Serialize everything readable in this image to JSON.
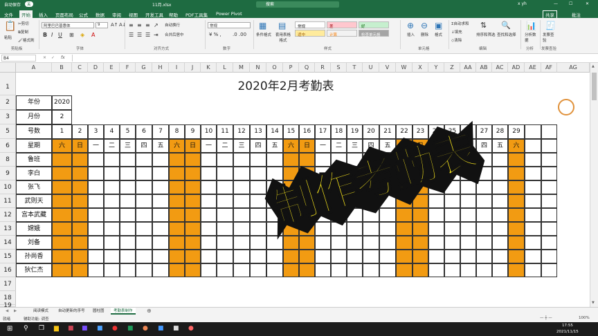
{
  "titlebar": {
    "autosave": "自动保存",
    "autosave_state": "关",
    "filename": "11月.xlsx",
    "search": "搜索",
    "user": "x yh"
  },
  "menu": {
    "tabs": [
      "文件",
      "开始",
      "插入",
      "页面布局",
      "公式",
      "数据",
      "审阅",
      "视图",
      "开发工具",
      "帮助",
      "PDF工具集",
      "Power Pivot"
    ],
    "active": "开始",
    "share": "共享",
    "comment": "批注"
  },
  "ribbon": {
    "clipboard": {
      "paste": "粘贴",
      "cut": "剪切",
      "copy": "复制",
      "format_painter": "格式刷",
      "label": "剪贴板"
    },
    "font": {
      "name": "阿里巴巴普惠体",
      "size": "9",
      "label": "字体"
    },
    "alignment": {
      "wrap": "自动换行",
      "merge": "合并后居中",
      "label": "对齐方式"
    },
    "number": {
      "format": "常规",
      "label": "数字"
    },
    "styles": {
      "cond": "条件格式",
      "table": "套用表格格式",
      "normal": "常规",
      "bad": "差",
      "good": "好",
      "neutral": "适中",
      "calc": "计算",
      "check": "检查单元格",
      "label": "样式"
    },
    "cells": {
      "insert": "插入",
      "delete": "删除",
      "format": "格式",
      "label": "单元格"
    },
    "editing": {
      "autosum": "自动求和",
      "fill": "填充",
      "clear": "清除",
      "sort": "排序和筛选",
      "find": "查找和选择",
      "label": "编辑"
    },
    "analysis": {
      "analyze": "分析数据",
      "label": "分析"
    },
    "invoice": {
      "check": "发票查验",
      "label": "发票查验"
    }
  },
  "formula_bar": {
    "name_box": "B4",
    "fx": "fx",
    "value": ""
  },
  "columns": [
    "A",
    "B",
    "C",
    "D",
    "E",
    "F",
    "G",
    "H",
    "I",
    "J",
    "K",
    "L",
    "M",
    "N",
    "O",
    "P",
    "Q",
    "R",
    "S",
    "T",
    "U",
    "V",
    "W",
    "X",
    "Y",
    "Z",
    "AA",
    "AB",
    "AC",
    "AD",
    "AE",
    "AF",
    "AG"
  ],
  "rows": [
    "1",
    "2",
    "3",
    "5",
    "6",
    "8",
    "9",
    "10",
    "11",
    "12",
    "13",
    "14",
    "15",
    "16",
    "17",
    "18",
    "19"
  ],
  "sheet": {
    "title": "2020年2月考勤表",
    "year_label": "年份",
    "year": "2020",
    "month_label": "月份",
    "month": "2",
    "day_label": "号数",
    "weekday_label": "星期",
    "days": [
      "1",
      "2",
      "3",
      "4",
      "5",
      "6",
      "7",
      "8",
      "9",
      "10",
      "11",
      "12",
      "13",
      "14",
      "15",
      "16",
      "17",
      "18",
      "19",
      "20",
      "21",
      "22",
      "23",
      "24",
      "25",
      "26",
      "27",
      "28",
      "29",
      "",
      ""
    ],
    "weekdays": [
      "六",
      "日",
      "一",
      "二",
      "三",
      "四",
      "五",
      "六",
      "日",
      "一",
      "二",
      "三",
      "四",
      "五",
      "六",
      "日",
      "一",
      "二",
      "三",
      "四",
      "五",
      "六",
      "日",
      "一",
      "二",
      "三",
      "四",
      "五",
      "六",
      "",
      ""
    ],
    "weekend_days": [
      1,
      2,
      8,
      9,
      15,
      16,
      22,
      23,
      29
    ],
    "names": [
      "鲁班",
      "李白",
      "张飞",
      "武则天",
      "宫本武藏",
      "嫦娥",
      "刘备",
      "孙尚香",
      "狄仁杰"
    ]
  },
  "overlay_text": "制作考勤表",
  "sheet_tabs": [
    "阅读模式",
    "自动更新的序号",
    "圆柱图",
    "考勤表制作"
  ],
  "active_sheet": "考勤表制作",
  "status": {
    "ready": "就绪",
    "accessibility": "辅助功能: 调查",
    "zoom": "100%"
  },
  "taskbar": {
    "time": "17:55",
    "date": "2021/11/15"
  }
}
